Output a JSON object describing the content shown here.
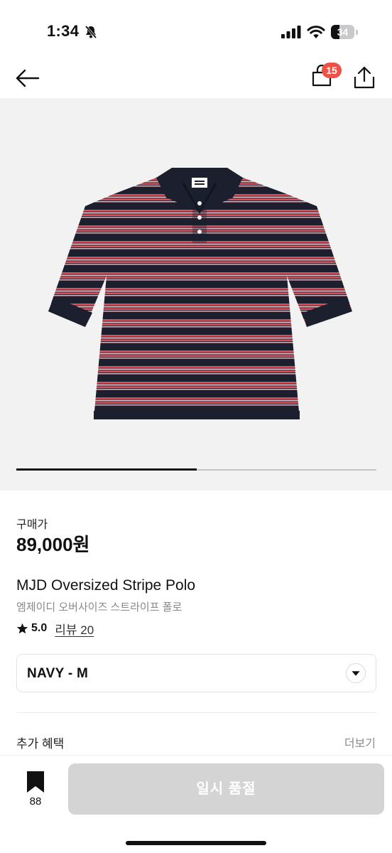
{
  "status_bar": {
    "time": "1:34",
    "battery_level": "34",
    "icons": [
      "bell-slash-icon",
      "cellular-signal-icon",
      "wifi-icon",
      "battery-icon"
    ]
  },
  "nav": {
    "icons": [
      "arrow-left-icon",
      "shopping-bag-icon",
      "share-icon"
    ],
    "bag_count": "15"
  },
  "gallery": {
    "image_subject": "navy and red striped polo shirt",
    "progress_fraction": 0.5
  },
  "product": {
    "price_label": "구매가",
    "price": "89,000원",
    "name_en": "MJD Oversized Stripe Polo",
    "name_ko": "엠제이디 오버사이즈 스트라이프 폴로",
    "rating": "5.0",
    "review_link": "리뷰 20"
  },
  "option": {
    "selected": "NAVY - M",
    "icon": "chevron-down-icon"
  },
  "benefits": {
    "title": "추가 혜택",
    "more": "더보기"
  },
  "bottom_bar": {
    "bookmark_count": "88",
    "sold_out_label": "일시 품절",
    "icons": [
      "bookmark-icon"
    ]
  },
  "colors": {
    "accent_badge": "#ef5145",
    "disabled_button": "#d4d4d4",
    "shirt_navy": "#1b1f2e",
    "shirt_red": "#e0505a",
    "shirt_pink": "#f4a9ae"
  }
}
